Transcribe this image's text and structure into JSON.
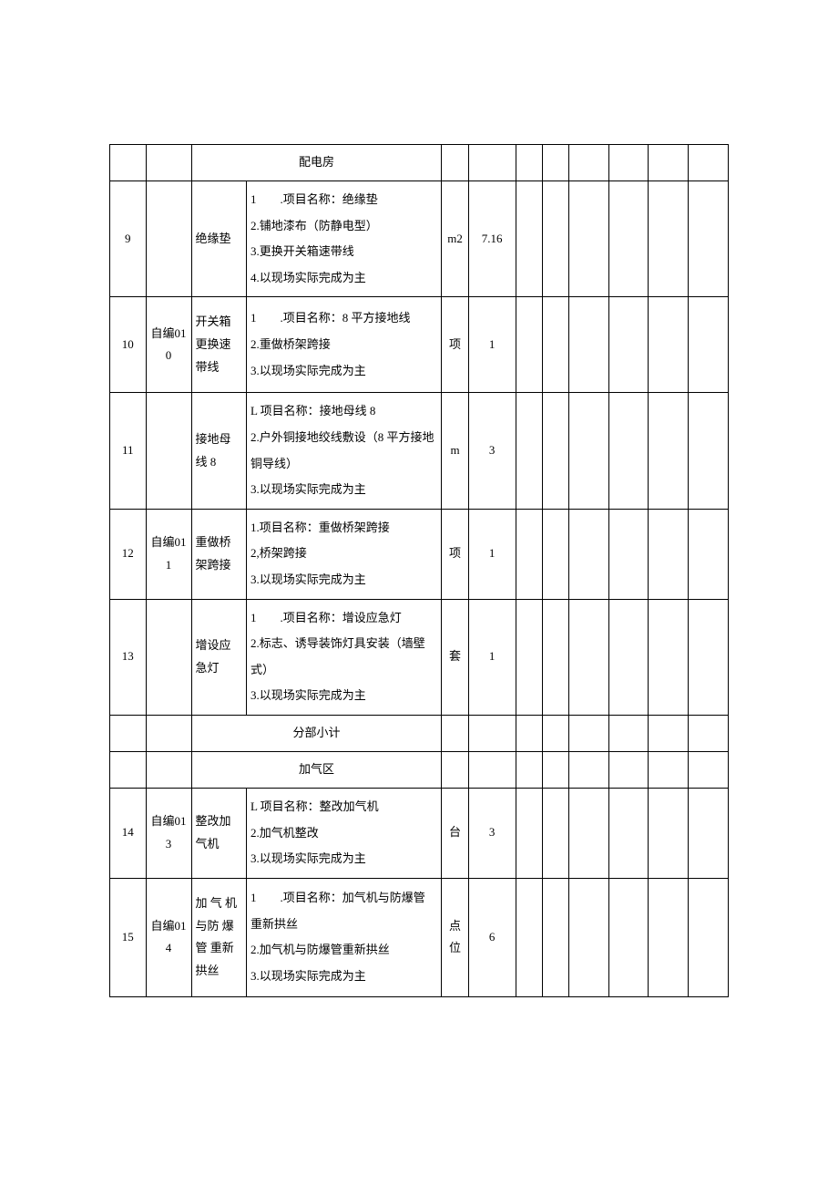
{
  "sections": {
    "s1": "配电房",
    "s2": "分部小计",
    "s3": "加气区"
  },
  "rows": {
    "r9": {
      "idx": "9",
      "code": "",
      "name": "绝缘垫",
      "desc": "1　　.项目名称：绝缘垫\n2.铺地漆布（防静电型）\n3.更换开关箱速带线\n4.以现场实际完成为主",
      "unit": "m2",
      "qty": "7.16"
    },
    "r10": {
      "idx": "10",
      "code": "自编010",
      "name": "开关箱更换速带线",
      "desc": "1　　.项目名称：8 平方接地线\n2.重做桥架跨接\n3.以现场实际完成为主",
      "unit": "项",
      "qty": "1"
    },
    "r11": {
      "idx": "11",
      "code": "",
      "name": "接地母线 8",
      "desc": "L 项目名称：接地母线 8\n2.户外铜接地绞线敷设（8 平方接地铜导线）\n3.以现场实际完成为主",
      "unit": "m",
      "qty": "3"
    },
    "r12": {
      "idx": "12",
      "code": "自编011",
      "name": "重做桥架跨接",
      "desc": "1.项目名称：重做桥架跨接\n2,桥架跨接\n3.以现场实际完成为主",
      "unit": "项",
      "qty": "1"
    },
    "r13": {
      "idx": "13",
      "code": "",
      "name": "增设应急灯",
      "desc": "1　　.项目名称：增设应急灯\n2.标志、诱导装饰灯具安装（墙壁式）\n3.以现场实际完成为主",
      "unit": "套",
      "qty": "1"
    },
    "r14": {
      "idx": "14",
      "code": "自编013",
      "name": "整改加气机",
      "desc": "L 项目名称：整改加气机\n2.加气机整改\n3.以现场实际完成为主",
      "unit": "台",
      "qty": "3"
    },
    "r15": {
      "idx": "15",
      "code": "自编014",
      "name": "加 气 机 与防 爆 管 重新拱丝",
      "desc": "1　　.项目名称：加气机与防爆管\n重新拱丝\n2.加气机与防爆管重新拱丝\n3.以现场实际完成为主",
      "unit": "点位",
      "qty": "6"
    }
  }
}
